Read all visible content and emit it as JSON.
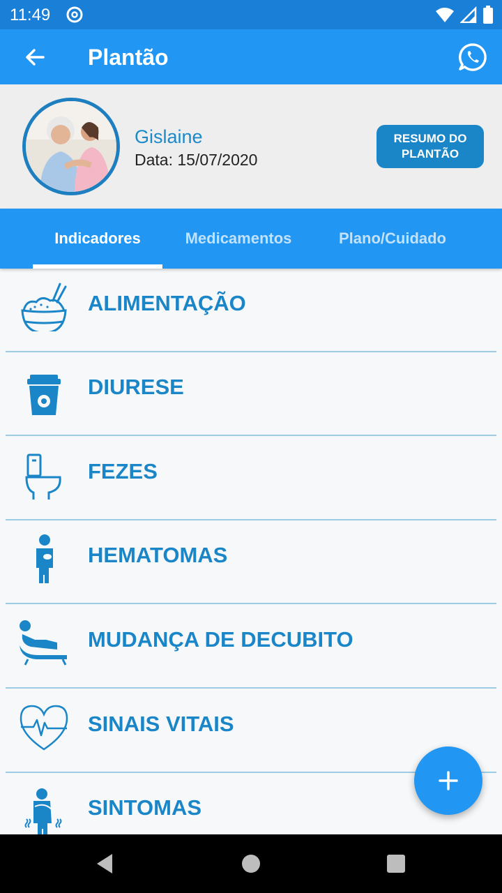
{
  "status_bar": {
    "time": "11:49",
    "icons": [
      "at-sign-icon",
      "wifi-icon",
      "signal-icon",
      "battery-icon"
    ]
  },
  "app_bar": {
    "title": "Plantão",
    "back_icon": "arrow-left-icon",
    "action_icon": "whatsapp-icon"
  },
  "patient": {
    "name": "Gislaine",
    "date_text": "Data: 15/07/2020",
    "summary_button": "RESUMO DO\nPLANTÃO"
  },
  "tabs": [
    {
      "label": "Indicadores",
      "active": true
    },
    {
      "label": "Medicamentos",
      "active": false
    },
    {
      "label": "Plano/Cuidado",
      "active": false
    }
  ],
  "indicators": [
    {
      "label": "ALIMENTAÇÃO",
      "icon": "rice-bowl-icon"
    },
    {
      "label": "DIURESE",
      "icon": "urine-cup-icon"
    },
    {
      "label": "FEZES",
      "icon": "toilet-icon"
    },
    {
      "label": "HEMATOMAS",
      "icon": "person-bruise-icon"
    },
    {
      "label": "MUDANÇA DE DECUBITO",
      "icon": "reclining-person-icon"
    },
    {
      "label": "SINAIS VITAIS",
      "icon": "heart-pulse-icon"
    },
    {
      "label": "SINTOMAS",
      "icon": "person-shivering-icon"
    }
  ],
  "fab": {
    "icon": "plus-icon"
  },
  "colors": {
    "primary": "#2196f3",
    "status_bar": "#1a7fd6",
    "accent_text": "#1a86c8",
    "divider": "#9ccbe6"
  }
}
